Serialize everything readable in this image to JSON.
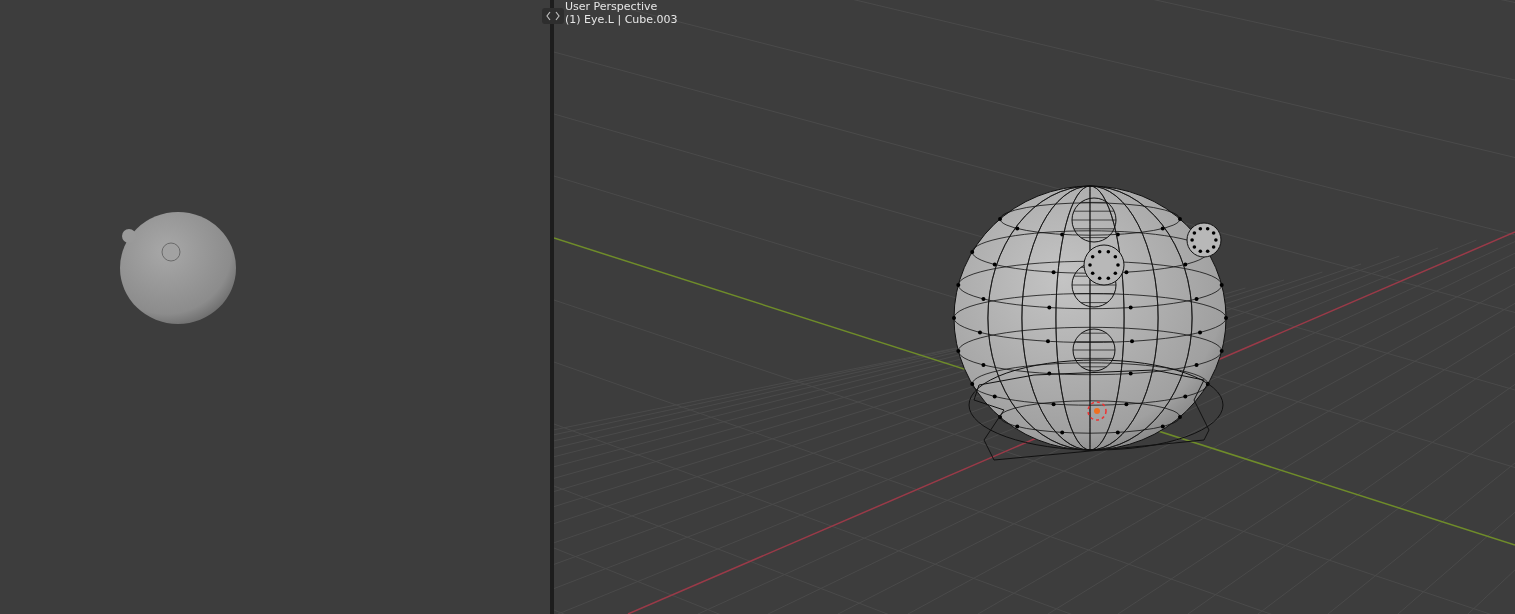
{
  "viewport": {
    "view_name": "User Perspective",
    "object_info": "(1) Eye.L | Cube.003"
  }
}
